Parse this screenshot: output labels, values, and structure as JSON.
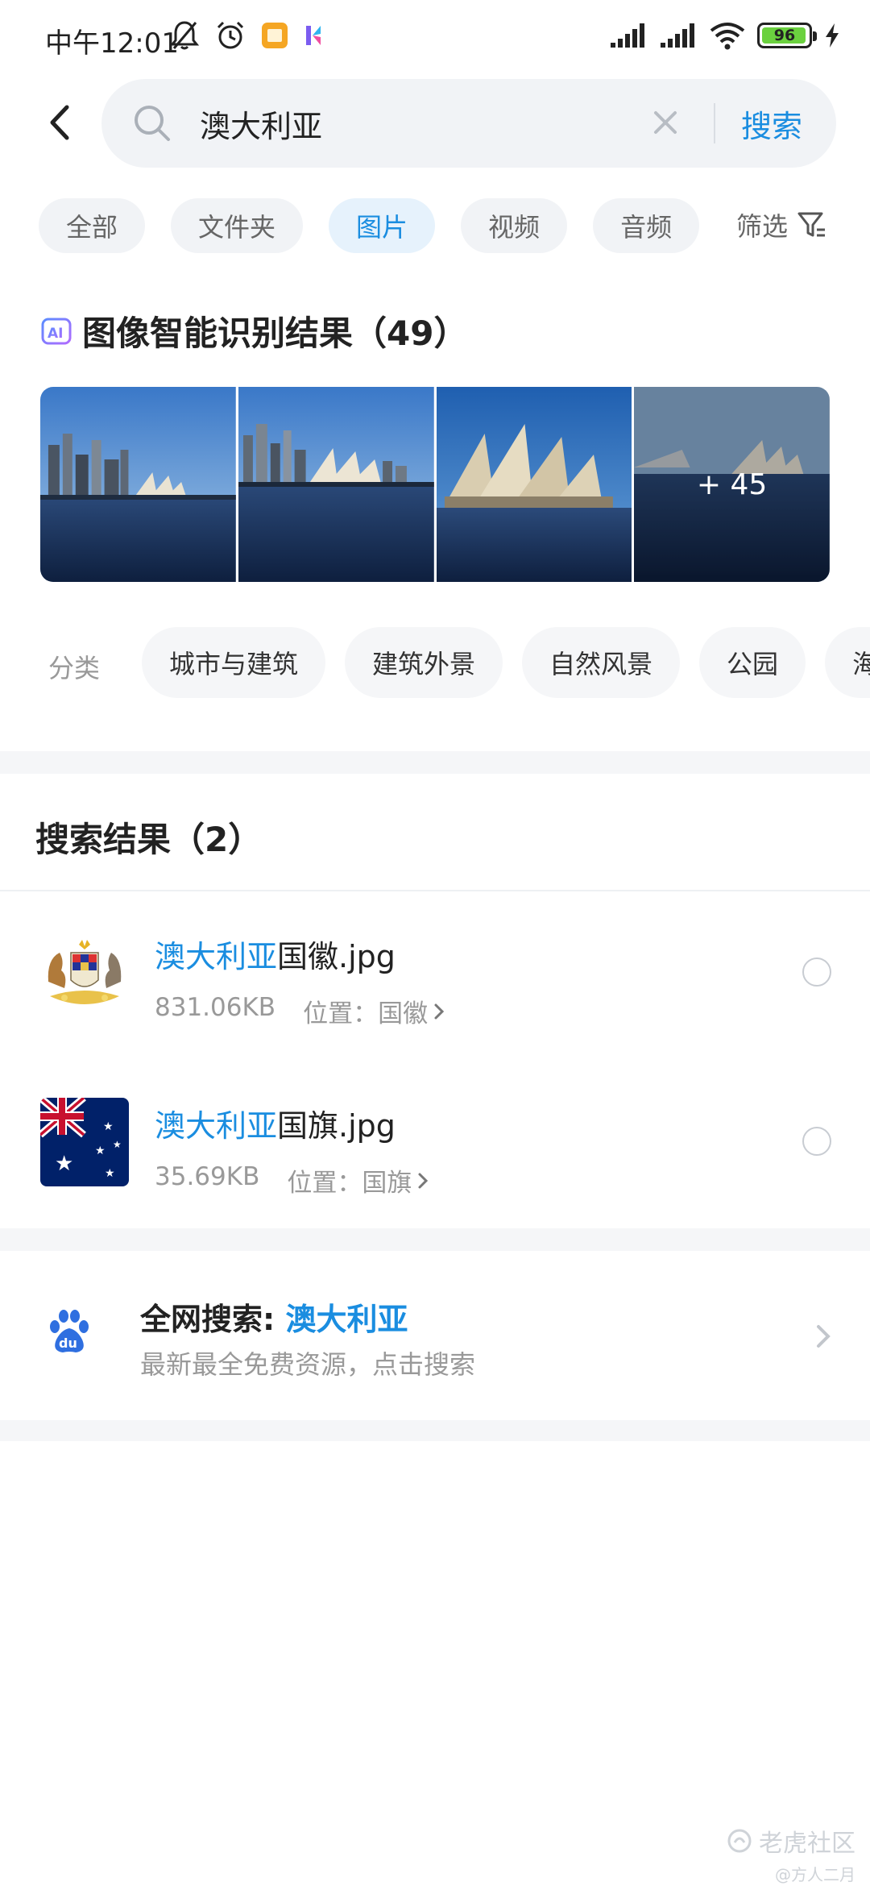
{
  "status_bar": {
    "time": "中午12:01",
    "battery": "96",
    "battery_percent": 96,
    "icons": [
      "mute-bell-icon",
      "alarm-icon",
      "notes-app-icon",
      "app-notification-icon",
      "signal-icon",
      "signal-icon",
      "wifi-icon",
      "charging-icon"
    ]
  },
  "search": {
    "query": "澳大利亚",
    "button_label": "搜索"
  },
  "filter_tabs": [
    {
      "label": "全部",
      "active": false
    },
    {
      "label": "文件夹",
      "active": false
    },
    {
      "label": "图片",
      "active": true
    },
    {
      "label": "视频",
      "active": false
    },
    {
      "label": "音频",
      "active": false
    }
  ],
  "filter": {
    "label": "筛选"
  },
  "ai_results": {
    "title": "图像智能识别结果（49）",
    "more_count": "+ 45"
  },
  "categories": {
    "label": "分类",
    "items": [
      "城市与建筑",
      "建筑外景",
      "自然风景",
      "公园",
      "海"
    ]
  },
  "search_results": {
    "title": "搜索结果（2）",
    "items": [
      {
        "name_highlight": "澳大利亚",
        "name_rest": "国徽.jpg",
        "size": "831.06KB",
        "location": "位置：国徽"
      },
      {
        "name_highlight": "澳大利亚",
        "name_rest": "国旗.jpg",
        "size": "35.69KB",
        "location": "位置：国旗"
      }
    ]
  },
  "web_search": {
    "title_prefix": "全网搜索: ",
    "title_keyword": "澳大利亚",
    "subtitle": "最新最全免费资源，点击搜索",
    "logo_text": "du"
  },
  "watermark": {
    "main": "老虎社区",
    "sub": "@方人二月"
  },
  "colors": {
    "accent": "#1a8de0",
    "chip_bg": "#f1f3f6",
    "active_tab_bg": "#e6f2fc",
    "battery": "#6bd13f"
  }
}
